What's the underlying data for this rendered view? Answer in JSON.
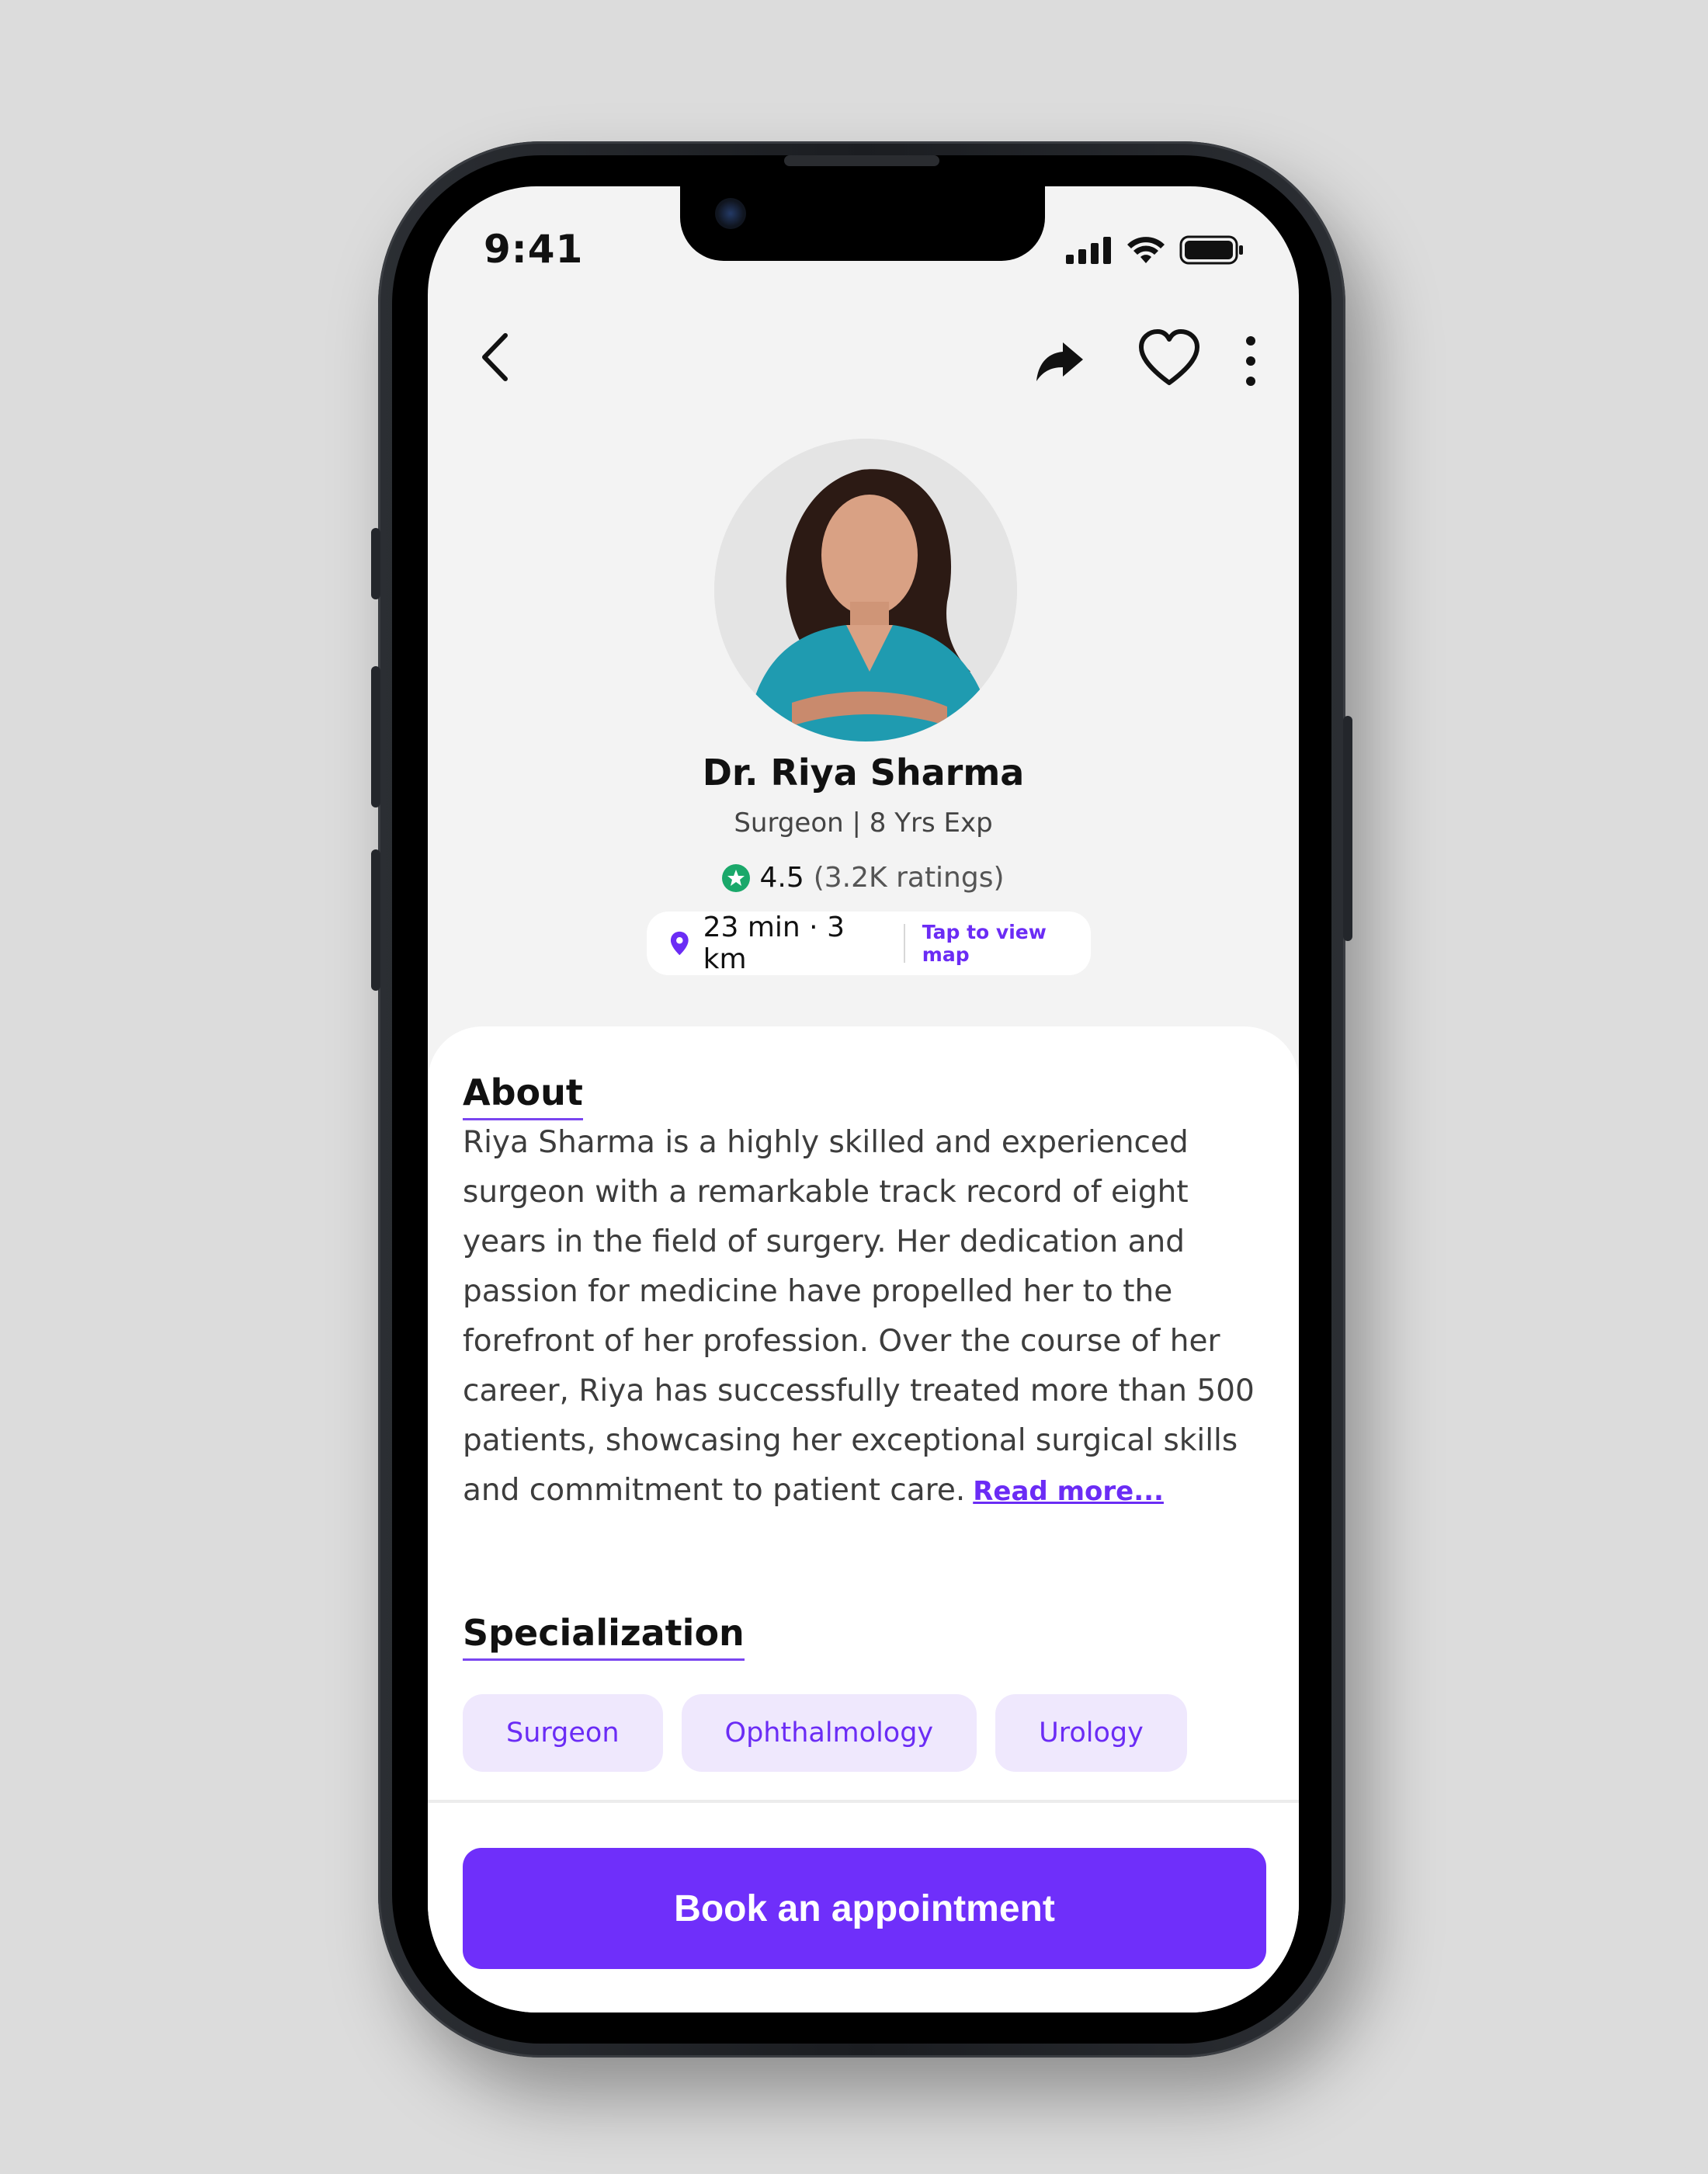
{
  "status_bar": {
    "time": "9:41",
    "icons": [
      "signal-icon",
      "wifi-icon",
      "battery-icon"
    ]
  },
  "nav": {
    "icons": [
      "back-icon",
      "share-icon",
      "heart-icon",
      "more-icon"
    ]
  },
  "doctor": {
    "name": "Dr. Riya Sharma",
    "subtitle": "Surgeon | 8 Yrs Exp",
    "rating": "4.5",
    "rating_count": "(3.2K ratings)",
    "distance": "23 min · 3 km",
    "map_link": "Tap to view map"
  },
  "about": {
    "title": "About",
    "text": "Riya Sharma is a highly skilled and experienced surgeon with a remarkable track record of eight years in the field of surgery. Her dedication and passion for medicine have propelled her to the forefront of her profession. Over the course of her career, Riya has successfully treated more than 500 patients, showcasing her exceptional surgical skills and commitment to patient care.",
    "read_more": "Read more..."
  },
  "specialization": {
    "title": "Specialization",
    "chips": [
      "Surgeon",
      "Ophthalmology",
      "Urology"
    ]
  },
  "cta": {
    "label": "Book an appointment"
  },
  "colors": {
    "accent": "#6f2ffa",
    "chip_bg": "#efe8fd",
    "star": "#1aa86a",
    "background": "#f3f3f3"
  }
}
